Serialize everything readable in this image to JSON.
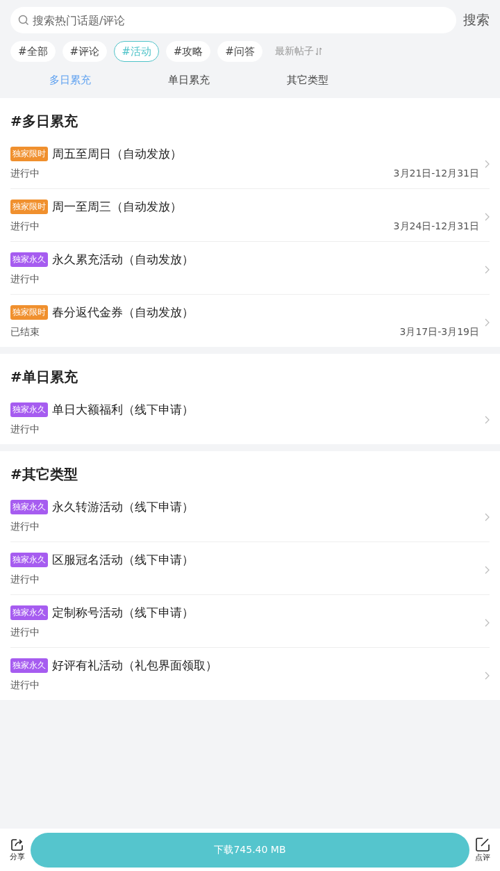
{
  "search": {
    "placeholder": "搜索热门话题/评论",
    "button": "搜索"
  },
  "chips": [
    {
      "label": "#全部",
      "selected": false
    },
    {
      "label": "#评论",
      "selected": false
    },
    {
      "label": "#活动",
      "selected": true
    },
    {
      "label": "#攻略",
      "selected": false
    },
    {
      "label": "#问答",
      "selected": false
    }
  ],
  "sort": {
    "label": "最新帖子"
  },
  "tabs": [
    {
      "label": "多日累充",
      "selected": true
    },
    {
      "label": "单日累充",
      "selected": false
    },
    {
      "label": "其它类型",
      "selected": false
    }
  ],
  "sections": [
    {
      "title": "#多日累充",
      "items": [
        {
          "tag": "独家限时",
          "color": "#f0902e",
          "title": "周五至周日（自动发放）",
          "status": "进行中",
          "date": "3月21日-12月31日"
        },
        {
          "tag": "独家限时",
          "color": "#f0902e",
          "title": "周一至周三（自动发放）",
          "status": "进行中",
          "date": "3月24日-12月31日"
        },
        {
          "tag": "独家永久",
          "color": "#a65cf0",
          "title": "永久累充活动（自动发放）",
          "status": "进行中"
        },
        {
          "tag": "独家限时",
          "color": "#f0902e",
          "title": "春分返代金券（自动发放）",
          "status": "已结束",
          "date": "3月17日-3月19日"
        }
      ]
    },
    {
      "title": "#单日累充",
      "items": [
        {
          "tag": "独家永久",
          "color": "#a65cf0",
          "title": "单日大额福利（线下申请）",
          "status": "进行中"
        }
      ]
    },
    {
      "title": "#其它类型",
      "items": [
        {
          "tag": "独家永久",
          "color": "#a65cf0",
          "title": "永久转游活动（线下申请）",
          "status": "进行中"
        },
        {
          "tag": "独家永久",
          "color": "#a65cf0",
          "title": "区服冠名活动（线下申请）",
          "status": "进行中"
        },
        {
          "tag": "独家永久",
          "color": "#a65cf0",
          "title": "定制称号活动（线下申请）",
          "status": "进行中"
        },
        {
          "tag": "独家永久",
          "color": "#a65cf0",
          "title": "好评有礼活动（礼包界面领取）",
          "status": "进行中"
        }
      ]
    }
  ],
  "bottom_bar": {
    "share": "分享",
    "download": "下载745.40 MB",
    "review": "点评"
  }
}
